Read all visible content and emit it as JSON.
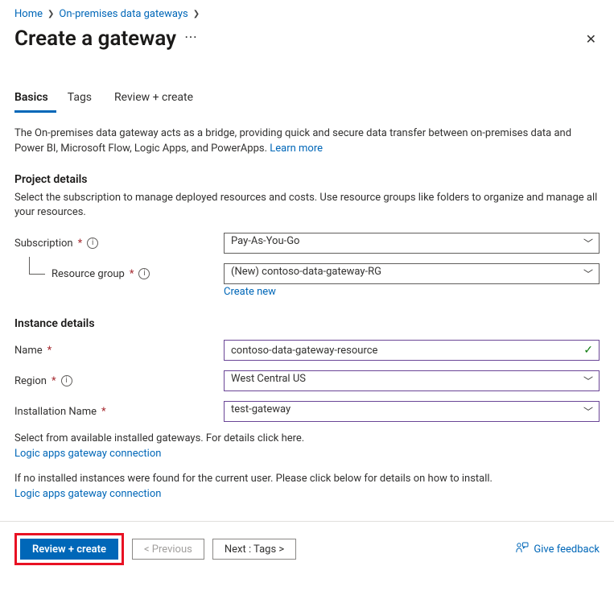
{
  "breadcrumb": {
    "home": "Home",
    "gateways": "On-premises data gateways"
  },
  "header": {
    "title": "Create a gateway"
  },
  "tabs": {
    "basics": "Basics",
    "tags": "Tags",
    "review": "Review + create"
  },
  "intro": {
    "text": "The On-premises data gateway acts as a bridge, providing quick and secure data transfer between on-premises data and Power BI, Microsoft Flow, Logic Apps, and PowerApps. ",
    "learn_more": "Learn more"
  },
  "project": {
    "header": "Project details",
    "sub": "Select the subscription to manage deployed resources and costs. Use resource groups like folders to organize and manage all your resources.",
    "subscription_label": "Subscription",
    "subscription_value": "Pay-As-You-Go",
    "resource_group_label": "Resource group",
    "resource_group_value": "(New) contoso-data-gateway-RG",
    "create_new": "Create new"
  },
  "instance": {
    "header": "Instance details",
    "name_label": "Name",
    "name_value": "contoso-data-gateway-resource",
    "region_label": "Region",
    "region_value": "West Central US",
    "install_label": "Installation Name",
    "install_value": "test-gateway"
  },
  "hints": {
    "select_text": "Select from available installed gateways. For details click here.",
    "select_link": "Logic apps gateway connection",
    "none_text": "If no installed instances were found for the current user. Please click below for details on how to install.",
    "none_link": "Logic apps gateway connection"
  },
  "footer": {
    "review": "Review + create",
    "previous": "< Previous",
    "next": "Next : Tags >",
    "feedback": "Give feedback"
  }
}
